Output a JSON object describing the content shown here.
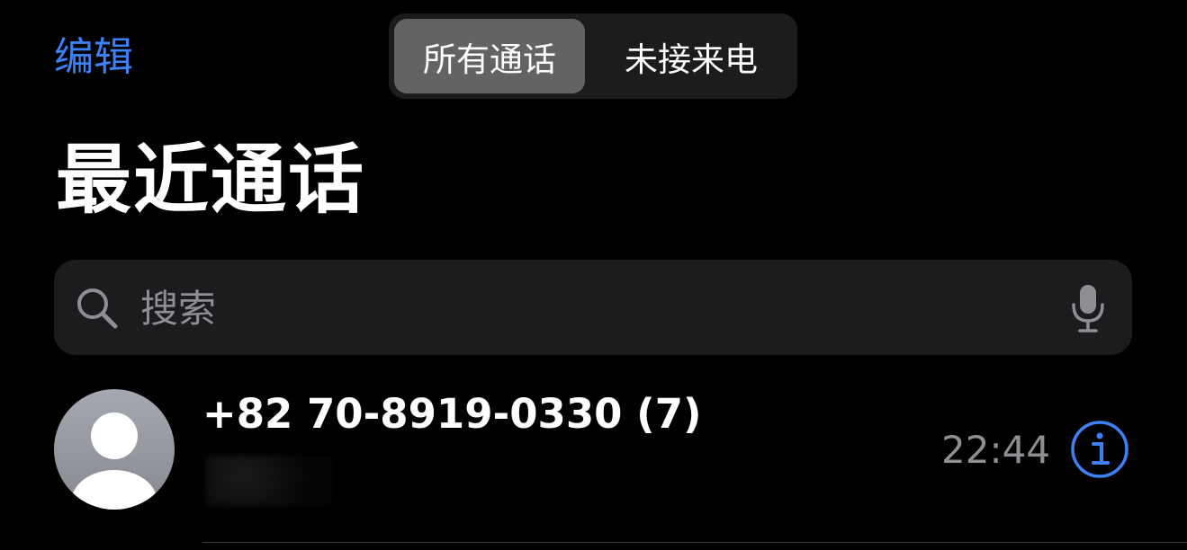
{
  "header": {
    "edit_label": "编辑",
    "segments": [
      {
        "label": "所有通话",
        "selected": true
      },
      {
        "label": "未接来电",
        "selected": false
      }
    ]
  },
  "page": {
    "title": "最近通话"
  },
  "search": {
    "placeholder": "搜索",
    "value": "",
    "icons": [
      "search-icon",
      "microphone-icon"
    ]
  },
  "calls": [
    {
      "caller": "+82 70-8919-0330 (7)",
      "time": "22:44",
      "avatar": "person-placeholder",
      "info_icon": "info-icon"
    }
  ],
  "colors": {
    "accent": "#3c82f6",
    "background": "#000000",
    "surface": "#1c1c1e",
    "selected_segment": "#636366",
    "secondary_text": "#8e8e93"
  }
}
